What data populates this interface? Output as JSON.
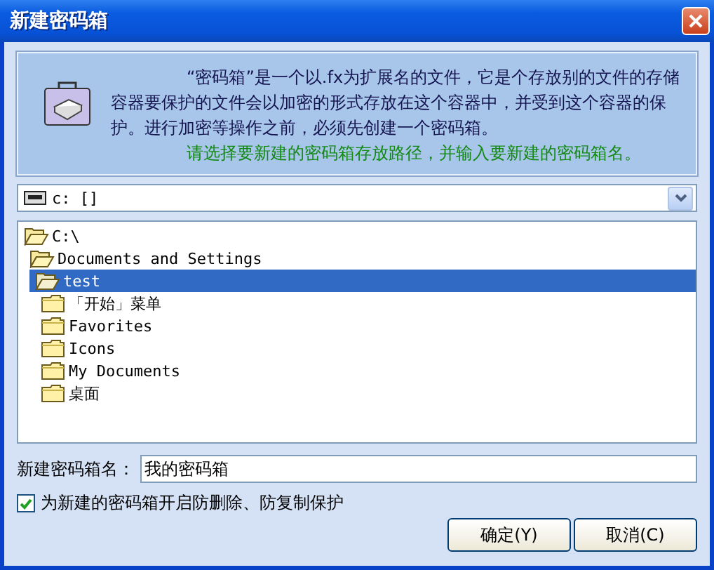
{
  "window": {
    "title": "新建密码箱"
  },
  "info": {
    "description": "“密码箱”是一个以.fx为扩展名的文件，它是个存放别的文件的存储容器要保护的文件会以加密的形式存放在这个容器中，并受到这个容器的保护。进行加密等操作之前，必须先创建一个密码箱。",
    "instruction": "请选择要新建的密码箱存放路径，并输入要新建的密码箱名。"
  },
  "drive": {
    "value": "c: []"
  },
  "tree": [
    {
      "label": "C:\\",
      "expanded": true,
      "selected": false,
      "children": [
        {
          "label": "Documents and Settings",
          "expanded": true,
          "selected": false,
          "children": [
            {
              "label": "test",
              "expanded": true,
              "selected": true,
              "children": [
                {
                  "label": "「开始」菜单",
                  "expanded": false,
                  "selected": false
                },
                {
                  "label": "Favorites",
                  "expanded": false,
                  "selected": false
                },
                {
                  "label": "Icons",
                  "expanded": false,
                  "selected": false
                },
                {
                  "label": "My Documents",
                  "expanded": false,
                  "selected": false
                },
                {
                  "label": "桌面",
                  "expanded": false,
                  "selected": false
                }
              ]
            }
          ]
        }
      ]
    }
  ],
  "name_field": {
    "label": "新建密码箱名：",
    "value": "我的密码箱"
  },
  "protect_checkbox": {
    "label": "为新建的密码箱开启防删除、防复制保护",
    "checked": true
  },
  "buttons": [
    {
      "label": "确定(Y)"
    },
    {
      "label": "取消(C)"
    }
  ]
}
